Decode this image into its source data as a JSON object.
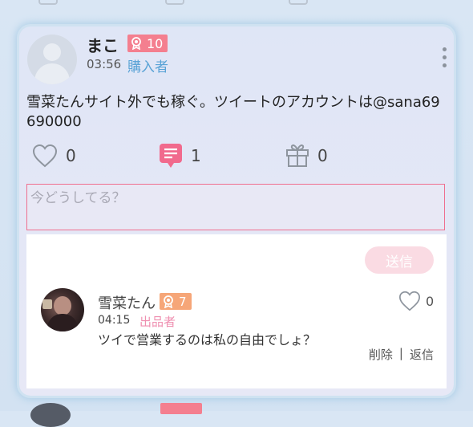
{
  "post": {
    "username": "まこ",
    "badge_level": "10",
    "time": "03:56",
    "role": "購入者",
    "text": "雪菜たんサイト外でも稼ぐ。ツイートのアカウントは@sana69690000",
    "like_count": "0",
    "comment_count": "1",
    "gift_count": "0",
    "icons": {
      "like": "heart-outline-icon",
      "comment": "comment-bubble-icon",
      "gift": "gift-icon",
      "menu": "more-vertical-icon",
      "badge": "medal-icon"
    }
  },
  "compose": {
    "placeholder": "今どうしてる？",
    "send_label": "送信"
  },
  "reply": {
    "username": "雪菜たん",
    "badge_level": "7",
    "time": "04:15",
    "role": "出品者",
    "text": "ツイで営業するのは私の自由でしょ？",
    "like_count": "0",
    "delete_label": "削除",
    "separator": "|",
    "reply_label": "返信"
  },
  "colors": {
    "accent_pink": "#f47f8f",
    "badge_orange": "#f6a678",
    "buyer_blue": "#5aa3d6",
    "seller_pink": "#ef8fb0",
    "send_button_disabled": "#fadbe3"
  }
}
